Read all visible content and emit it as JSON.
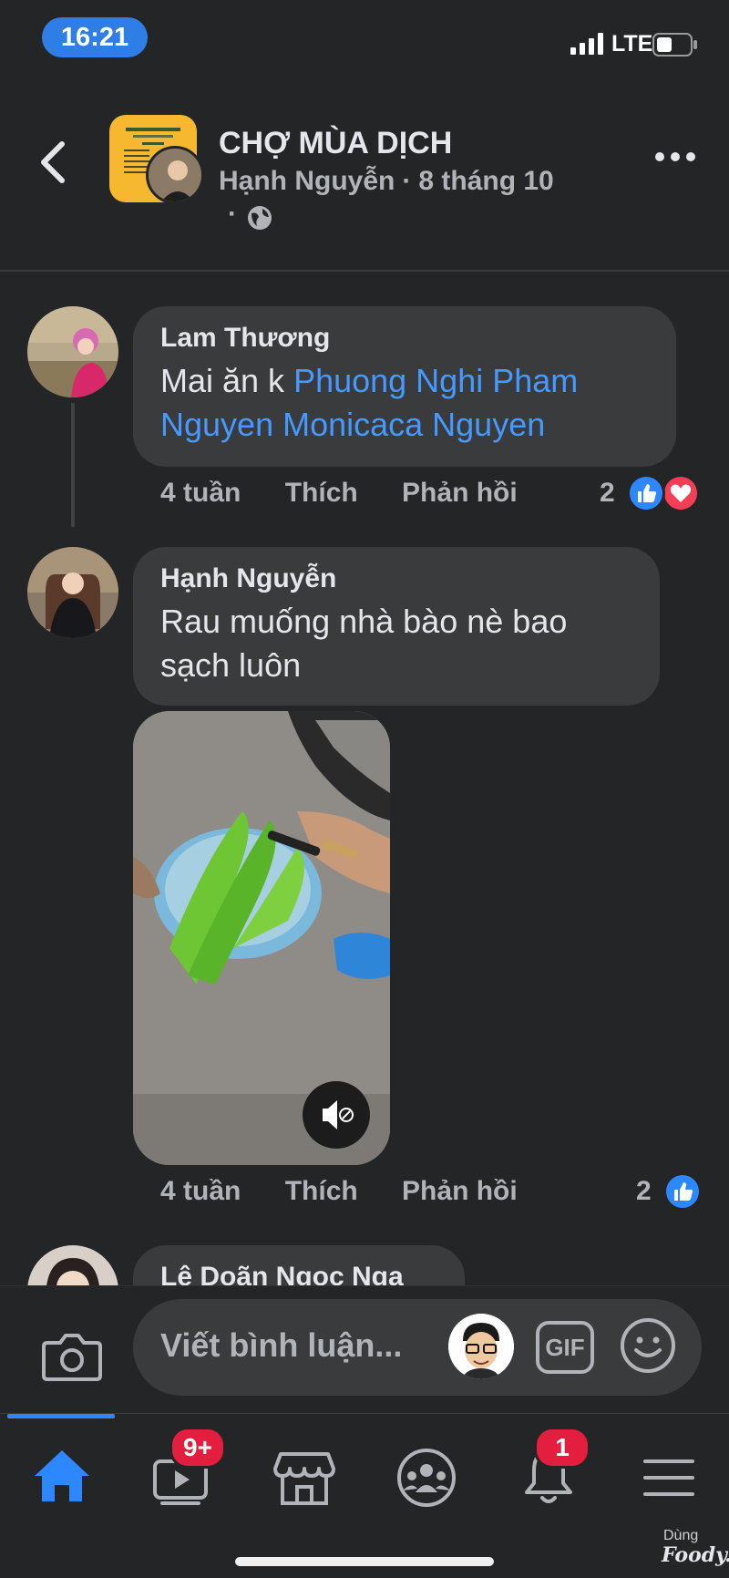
{
  "status_bar": {
    "time": "16:21",
    "network": "LTE"
  },
  "header": {
    "group_name": "CHỢ MÙA DỊCH",
    "author": "Hạnh Nguyễn",
    "separator": "·",
    "date": "8 tháng 10",
    "privacy_dot": "·",
    "privacy_icon": "globe-icon"
  },
  "comments": [
    {
      "author": "Lam Thương",
      "text_prefix": "Mai ăn k ",
      "mentions": "Phuong Nghi Pham Nguyen Monicaca Nguyen",
      "time": "4 tuần",
      "like_label": "Thích",
      "reply_label": "Phản hồi",
      "reaction_count": "2",
      "reactions": [
        "like-icon",
        "love-icon"
      ]
    },
    {
      "author": "Hạnh Nguyễn",
      "text": "Rau muống nhà bào nè bao sạch luôn",
      "media": "video",
      "time": "4 tuần",
      "like_label": "Thích",
      "reply_label": "Phản hồi",
      "reaction_count": "2",
      "reactions": [
        "like-icon"
      ]
    },
    {
      "author": "Lê Doãn Ngọc Nga"
    }
  ],
  "composer": {
    "placeholder": "Viết bình luận...",
    "gif_label": "GIF"
  },
  "nav": {
    "items": [
      "home-icon",
      "watch-icon",
      "marketplace-icon",
      "groups-icon",
      "notifications-icon",
      "menu-icon"
    ],
    "watch_badge": "9+",
    "notifications_badge": "1"
  },
  "watermark": {
    "label": "Dùng",
    "brand": "Foody.vn"
  },
  "colors": {
    "accent": "#2d88ff",
    "mention": "#4599ff",
    "badge": "#e41e3f",
    "background": "#242526",
    "bubble": "#3a3b3c"
  }
}
